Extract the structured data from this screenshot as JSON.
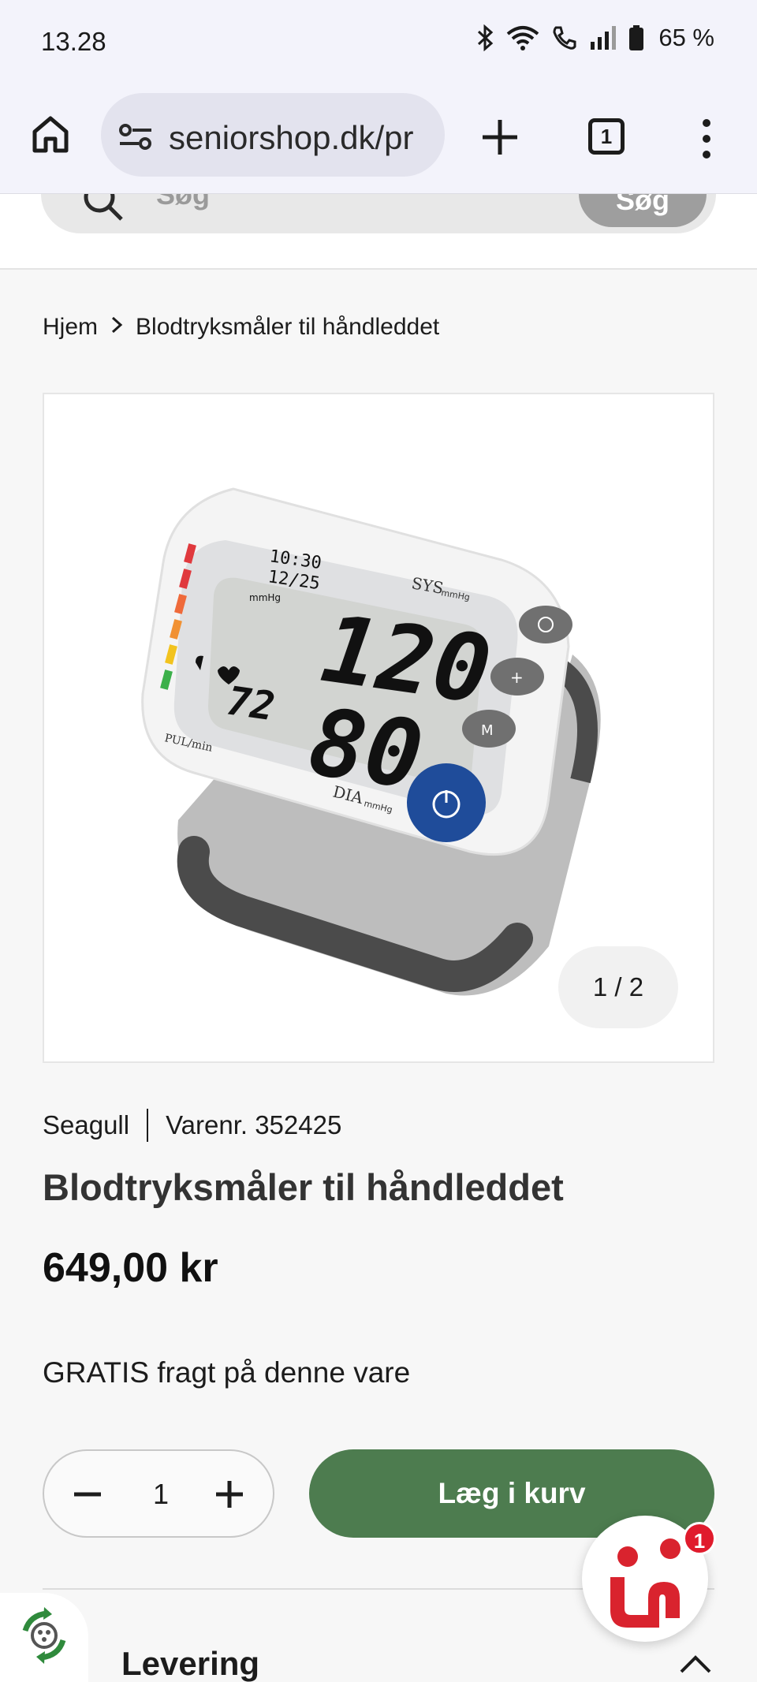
{
  "status_bar": {
    "time": "13.28",
    "battery": "65 %"
  },
  "browser": {
    "url": "seniorshop.dk/pr",
    "tab_count": "1"
  },
  "search": {
    "placeholder": "Søg",
    "button_label": "Søg"
  },
  "breadcrumb": {
    "home": "Hjem",
    "current": "Blodtryksmåler til håndleddet"
  },
  "gallery": {
    "counter": "1 / 2"
  },
  "product": {
    "brand": "Seagull",
    "sku_label": "Varenr. 352425",
    "title": "Blodtryksmåler til håndleddet",
    "price": "649,00 kr",
    "shipping_note": "GRATIS fragt på denne vare"
  },
  "device_display": {
    "time": "10:30",
    "date": "12/25",
    "sys_label": "SYS",
    "unit": "mmHg",
    "sys_value": "120",
    "dia_label": "DIA",
    "dia_value": "80",
    "pulse_value": "72",
    "pulse_label": "PUL/min",
    "unit_small": "mmHg"
  },
  "cart": {
    "quantity": "1",
    "add_label": "Læg i kurv"
  },
  "accordion": {
    "delivery_label": "Levering"
  },
  "chat": {
    "unread": "1"
  },
  "colors": {
    "accent_green": "#4d7c4f",
    "badge_red": "#e01b2c"
  }
}
